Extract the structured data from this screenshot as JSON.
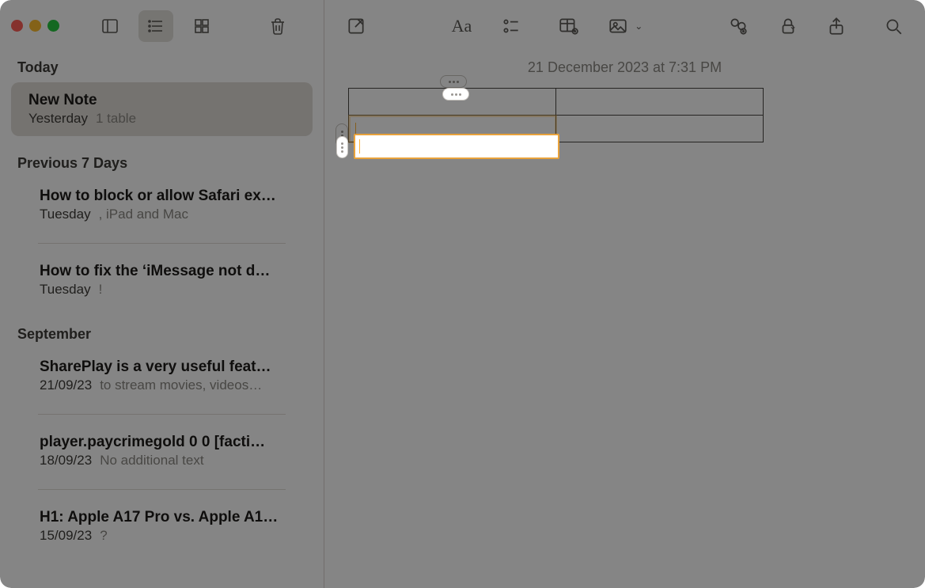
{
  "editor": {
    "timestamp": "21 December 2023 at 7:31 PM",
    "table": {
      "rows": 2,
      "cols": 2,
      "active_row": 1,
      "active_col": 0
    }
  },
  "sidebar": {
    "sections": [
      {
        "label": "Today",
        "items": [
          {
            "title": "New Note",
            "date": "Yesterday",
            "preview": "1 table",
            "selected": true
          }
        ]
      },
      {
        "label": "Previous 7 Days",
        "items": [
          {
            "title": "How to block or allow Safari ex…",
            "date": "Tuesday",
            "preview": ", iPad and Mac"
          },
          {
            "title": "How to fix the ‘iMessage not d…",
            "date": "Tuesday",
            "preview": "!"
          }
        ]
      },
      {
        "label": "September",
        "items": [
          {
            "title": "SharePlay is a very useful feat…",
            "date": "21/09/23",
            "preview": "to stream movies, videos…"
          },
          {
            "title": "player.paycrimegold 0 0 [facti…",
            "date": "18/09/23",
            "preview": "No additional text"
          },
          {
            "title": "H1: Apple A17 Pro vs. Apple A1…",
            "date": "15/09/23",
            "preview": "?"
          }
        ]
      }
    ]
  },
  "toolbar": {
    "view_list": true
  }
}
